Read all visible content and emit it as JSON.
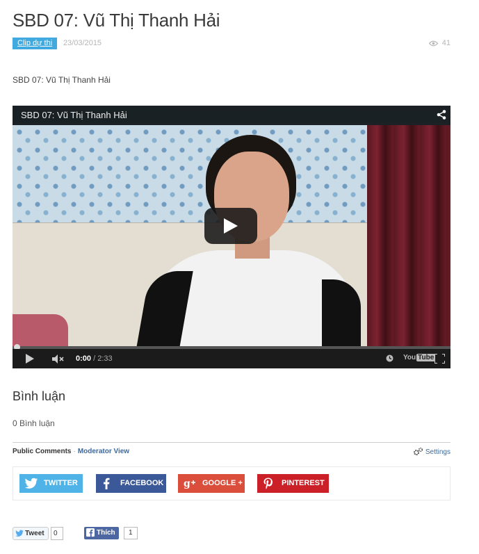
{
  "post": {
    "title": "SBD 07: Vũ Thị Thanh Hải",
    "category": "Clip dự thi",
    "date": "23/03/2015",
    "views": "41",
    "intro": "SBD 07: Vũ Thị Thanh Hải"
  },
  "video": {
    "title": "SBD 07: Vũ Thị Thanh Hải",
    "current_time": "0:00",
    "duration": "/ 2:33",
    "brand": "You",
    "brand_tube": "Tube",
    "progress": 0
  },
  "comments": {
    "heading": "Bình luận",
    "count_text": "0 Bình luận",
    "public_label": "Public Comments",
    "separator": "·",
    "moderator_label": "Moderator View",
    "settings_label": "Settings"
  },
  "share": {
    "twitter": "TWITTER",
    "facebook": "FACEBOOK",
    "google": "GOOGLE +",
    "pinterest": "PINTEREST"
  },
  "social": {
    "tweet_label": "Tweet",
    "tweet_count": "0",
    "like_label": "Thích",
    "like_count": "1"
  },
  "colors": {
    "accent": "#3fa9e0",
    "twitter": "#4fb3e8",
    "facebook": "#3b5998",
    "google": "#dc4e3c",
    "pinterest": "#cb2027"
  }
}
